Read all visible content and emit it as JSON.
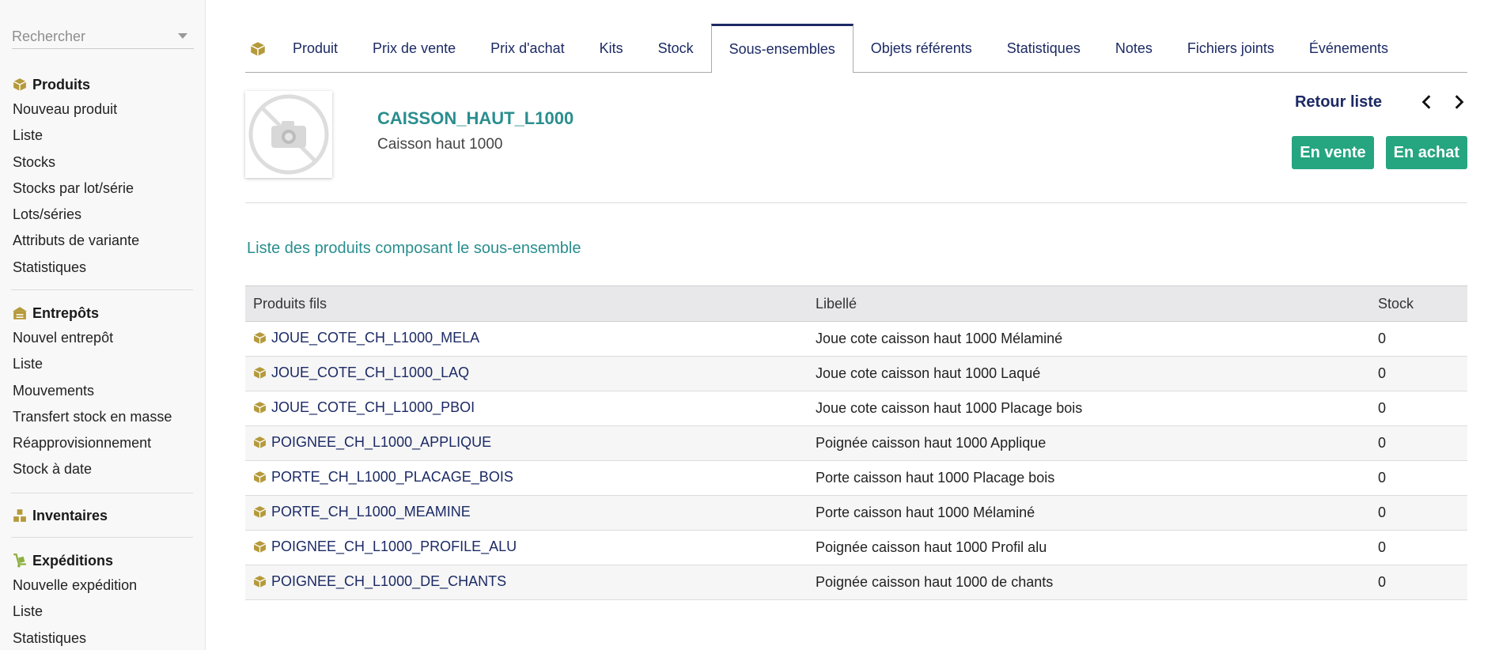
{
  "sidebar": {
    "search_placeholder": "Rechercher",
    "sections": [
      {
        "title": "Produits",
        "icon": "box-icon",
        "items": [
          "Nouveau produit",
          "Liste",
          "Stocks",
          "Stocks par lot/série",
          "Lots/séries",
          "Attributs de variante",
          "Statistiques"
        ]
      },
      {
        "title": "Entrepôts",
        "icon": "warehouse-icon",
        "items": [
          "Nouvel entrepôt",
          "Liste",
          "Mouvements",
          "Transfert stock en masse",
          "Réapprovisionnement",
          "Stock à date"
        ]
      },
      {
        "title": "Inventaires",
        "icon": "boxes-stack-icon",
        "items": []
      },
      {
        "title": "Expéditions",
        "icon": "dolly-icon",
        "items": [
          "Nouvelle expédition",
          "Liste",
          "Statistiques"
        ]
      }
    ]
  },
  "tabs": {
    "items": [
      "Produit",
      "Prix de vente",
      "Prix d'achat",
      "Kits",
      "Stock",
      "Sous-ensembles",
      "Objets référents",
      "Statistiques",
      "Notes",
      "Fichiers joints",
      "Événements"
    ],
    "active": "Sous-ensembles"
  },
  "product": {
    "ref": "CAISSON_HAUT_L1000",
    "label": "Caisson haut 1000"
  },
  "nav": {
    "back_label": "Retour liste"
  },
  "badges": {
    "sale": "En vente",
    "purchase": "En achat"
  },
  "section_title": "Liste des produits composant le sous-ensemble",
  "table": {
    "headers": [
      "Produits fils",
      "Libellé",
      "Stock"
    ],
    "rows": [
      {
        "ref": "JOUE_COTE_CH_L1000_MELA",
        "label": "Joue cote caisson haut 1000 Mélaminé",
        "stock": "0"
      },
      {
        "ref": "JOUE_COTE_CH_L1000_LAQ",
        "label": "Joue cote caisson haut 1000 Laqué",
        "stock": "0"
      },
      {
        "ref": "JOUE_COTE_CH_L1000_PBOI",
        "label": "Joue cote caisson haut 1000 Placage bois",
        "stock": "0"
      },
      {
        "ref": "POIGNEE_CH_L1000_APPLIQUE",
        "label": "Poignée caisson haut 1000 Applique",
        "stock": "0"
      },
      {
        "ref": "PORTE_CH_L1000_PLACAGE_BOIS",
        "label": "Porte caisson haut 1000 Placage bois",
        "stock": "0"
      },
      {
        "ref": "PORTE_CH_L1000_MEAMINE",
        "label": "Porte caisson haut 1000 Mélaminé",
        "stock": "0"
      },
      {
        "ref": "POIGNEE_CH_L1000_PROFILE_ALU",
        "label": "Poignée caisson haut 1000 Profil alu",
        "stock": "0"
      },
      {
        "ref": "POIGNEE_CH_L1000_DE_CHANTS",
        "label": "Poignée caisson haut 1000 de chants",
        "stock": "0"
      }
    ]
  },
  "colors": {
    "accent": "#1c2a64",
    "teal": "#2a8e8e",
    "button_green": "#25a580",
    "icon_gold": "#b59a3b"
  }
}
